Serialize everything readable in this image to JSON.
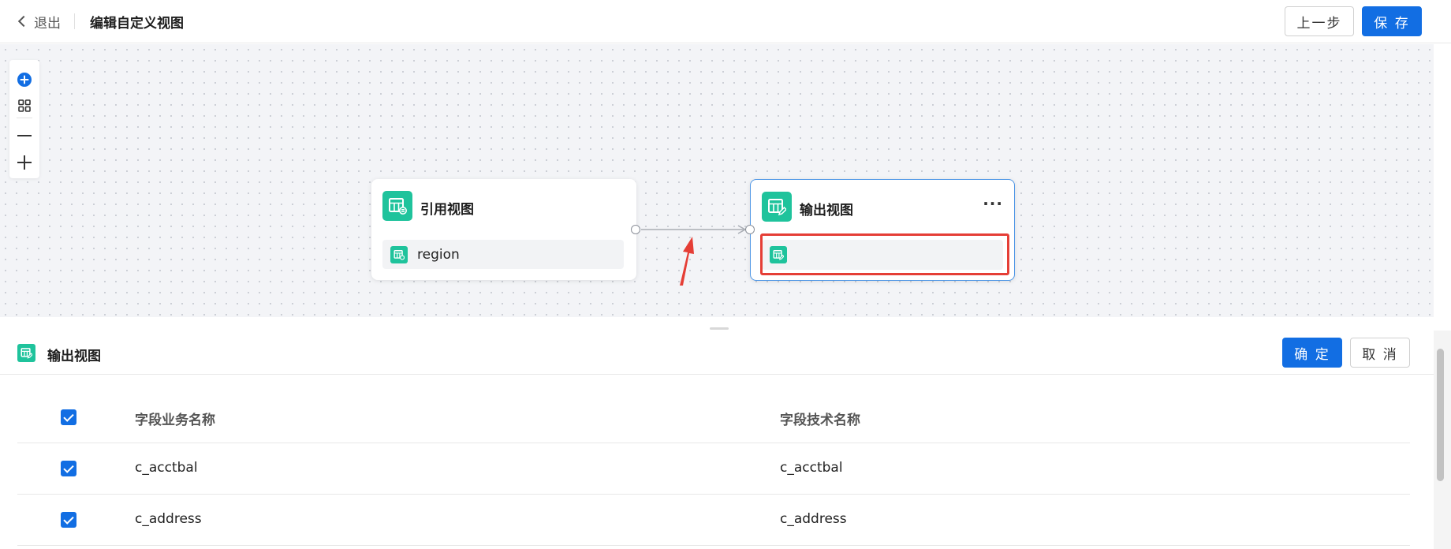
{
  "header": {
    "back_label": "退出",
    "title": "编辑自定义视图",
    "prev_label": "上一步",
    "save_label": "保 存"
  },
  "canvas": {
    "toolbar": [
      "add-node-icon",
      "grid-layout-icon",
      "zoom-out-icon",
      "zoom-in-icon"
    ],
    "nodes": [
      {
        "title": "引用视图",
        "row_label": "region",
        "icon": "table-view-icon"
      },
      {
        "title": "输出视图",
        "row_label": "",
        "icon": "table-edit-icon",
        "menu": "···"
      }
    ],
    "annotation": "red-arrow-and-highlight"
  },
  "panel": {
    "title": "输出视图",
    "confirm_label": "确 定",
    "cancel_label": "取 消",
    "columns": [
      "字段业务名称",
      "字段技术名称"
    ],
    "rows": [
      {
        "business_name": "c_acctbal",
        "technical_name": "c_acctbal",
        "checked": true
      },
      {
        "business_name": "c_address",
        "technical_name": "c_address",
        "checked": true
      }
    ]
  },
  "colors": {
    "primary": "#126ee3",
    "node_icon": "#1fc39c",
    "highlight": "#e53e36"
  }
}
